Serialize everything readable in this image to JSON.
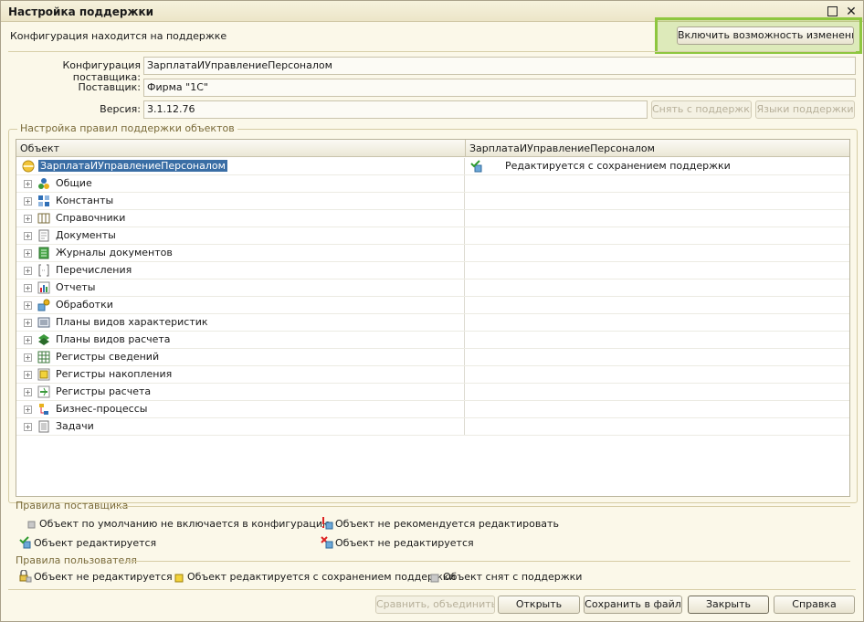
{
  "window": {
    "title": "Настройка поддержки"
  },
  "status": {
    "text": "Конфигурация находится на поддержке",
    "enable_button": "Включить возможность изменения"
  },
  "fields": {
    "vendor_config_label": "Конфигурация поставщика:",
    "vendor_config_value": "ЗарплатаИУправлениеПерсоналом",
    "vendor_label": "Поставщик:",
    "vendor_value": "Фирма \"1С\"",
    "version_label": "Версия:",
    "version_value": "3.1.12.76",
    "remove_support_button": "Снять с поддержки",
    "support_languages_button": "Языки поддержки"
  },
  "rules_group": {
    "title": "Настройка правил поддержки объектов",
    "columns": [
      "Объект",
      "ЗарплатаИУправлениеПерсоналом"
    ],
    "root": {
      "label": "ЗарплатаИУправлениеПерсоналом",
      "value": "Редактируется с сохранением поддержки"
    },
    "items": [
      {
        "label": "Общие",
        "icon": "common-icon"
      },
      {
        "label": "Константы",
        "icon": "constants-icon"
      },
      {
        "label": "Справочники",
        "icon": "catalogs-icon"
      },
      {
        "label": "Документы",
        "icon": "documents-icon"
      },
      {
        "label": "Журналы документов",
        "icon": "document-journals-icon"
      },
      {
        "label": "Перечисления",
        "icon": "enums-icon"
      },
      {
        "label": "Отчеты",
        "icon": "reports-icon"
      },
      {
        "label": "Обработки",
        "icon": "data-processors-icon"
      },
      {
        "label": "Планы видов характеристик",
        "icon": "characteristic-types-icon"
      },
      {
        "label": "Планы видов расчета",
        "icon": "calculation-types-icon"
      },
      {
        "label": "Регистры сведений",
        "icon": "information-registers-icon"
      },
      {
        "label": "Регистры накопления",
        "icon": "accumulation-registers-icon"
      },
      {
        "label": "Регистры расчета",
        "icon": "calculation-registers-icon"
      },
      {
        "label": "Бизнес-процессы",
        "icon": "business-processes-icon"
      },
      {
        "label": "Задачи",
        "icon": "tasks-icon"
      }
    ]
  },
  "vendor_rules": {
    "title": "Правила поставщика",
    "items": [
      "Объект по умолчанию не включается в конфигурацию",
      "Объект не рекомендуется редактировать",
      "Объект редактируется",
      "Объект не редактируется"
    ]
  },
  "user_rules": {
    "title": "Правила пользователя",
    "items": [
      "Объект не редактируется",
      "Объект редактируется с сохранением поддержки",
      "Объект снят с поддержки"
    ]
  },
  "footer": {
    "compare_merge": "Сравнить, объединить",
    "open": "Открыть",
    "save_to_file": "Сохранить в файл",
    "close": "Закрыть",
    "help": "Справка"
  },
  "colors": {
    "highlight": "#8ec63f",
    "selection": "#3a6ea5",
    "group_title": "#7a6b3a"
  }
}
